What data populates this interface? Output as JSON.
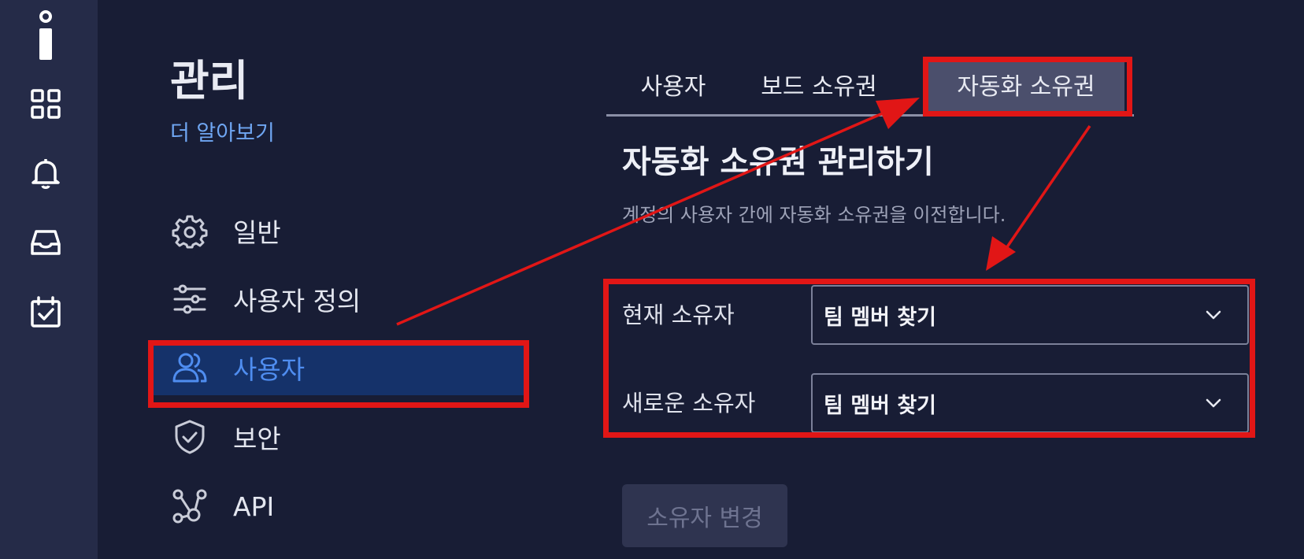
{
  "sidebar_rail": {
    "logo": "info-logo",
    "icons": [
      "grid-icon",
      "bell-icon",
      "inbox-icon",
      "calendar-check-icon"
    ]
  },
  "page": {
    "title": "관리",
    "learn_more": "더 알아보기"
  },
  "nav": {
    "items": [
      {
        "label": "일반",
        "icon": "gear-icon"
      },
      {
        "label": "사용자 정의",
        "icon": "sliders-icon"
      },
      {
        "label": "사용자",
        "icon": "users-icon",
        "active": true
      },
      {
        "label": "보안",
        "icon": "shield-check-icon"
      },
      {
        "label": "API",
        "icon": "api-nodes-icon"
      }
    ]
  },
  "tabs": {
    "items": [
      {
        "label": "사용자"
      },
      {
        "label": "보드 소유권"
      },
      {
        "label": "자동화 소유권",
        "selected": true
      }
    ]
  },
  "section": {
    "title": "자동화 소유권 관리하기",
    "description": "계정의 사용자 간에 자동화 소유권을 이전합니다."
  },
  "form": {
    "current_owner_label": "현재 소유자",
    "current_owner_value": "팀 멤버 찾기",
    "new_owner_label": "새로운 소유자",
    "new_owner_value": "팀 멤버 찾기",
    "submit_label": "소유자 변경"
  },
  "colors": {
    "background": "#181d35",
    "rail": "#252b48",
    "active_nav_bg": "#15326a",
    "active_nav_text": "#4f8df0",
    "link": "#6fa6f2",
    "annotation": "#e11616"
  }
}
